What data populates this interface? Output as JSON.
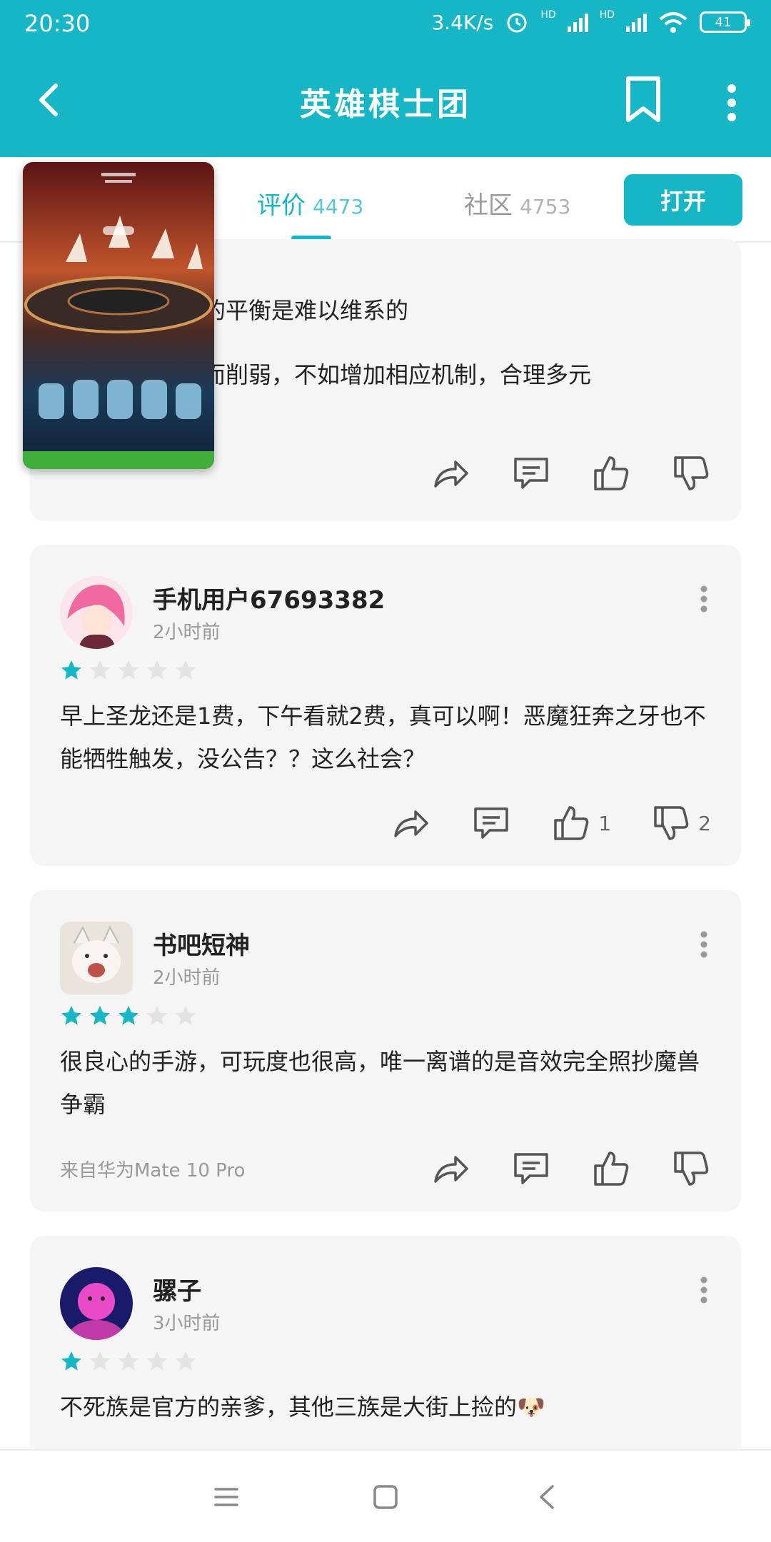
{
  "status": {
    "time": "20:30",
    "speed": "3.4K/s",
    "hd1": "HD",
    "hd2": "HD",
    "battery": "41"
  },
  "header": {
    "title": "英雄棋士团"
  },
  "tabs": {
    "review_label": "评价",
    "review_count": "4473",
    "community_label": "社区",
    "community_count": "4753",
    "open_label": "打开"
  },
  "colors": {
    "accent": "#17b6c6",
    "star_off": "#e3e3e3",
    "card_bg": "#f5f5f5"
  },
  "reviews": [
    {
      "partial_line1": "的平衡是难以维系的",
      "partial_line2": "而削弱，不如增加相应机制，合理多元"
    },
    {
      "name": "手机用户67693382",
      "time": "2小时前",
      "rating": 1,
      "text": "早上圣龙还是1费，下午看就2费，真可以啊！恶魔狂奔之牙也不能牺牲触发，没公告？？这么社会？",
      "likes": "1",
      "dislikes": "2"
    },
    {
      "name": "书吧短神",
      "time": "2小时前",
      "rating": 3,
      "text": "很良心的手游，可玩度也很高，唯一离谱的是音效完全照抄魔兽争霸",
      "device": "来自华为Mate 10 Pro"
    },
    {
      "name": "骡子",
      "time": "3小时前",
      "rating": 1,
      "text": "不死族是官方的亲爹，其他三族是大街上捡的🐶"
    }
  ],
  "icons": [
    "back-icon",
    "bookmark-icon",
    "more-icon",
    "share-icon",
    "comment-icon",
    "thumbs-up-icon",
    "thumbs-down-icon",
    "star-icon",
    "menu-icon",
    "home-icon",
    "nav-back-icon"
  ]
}
